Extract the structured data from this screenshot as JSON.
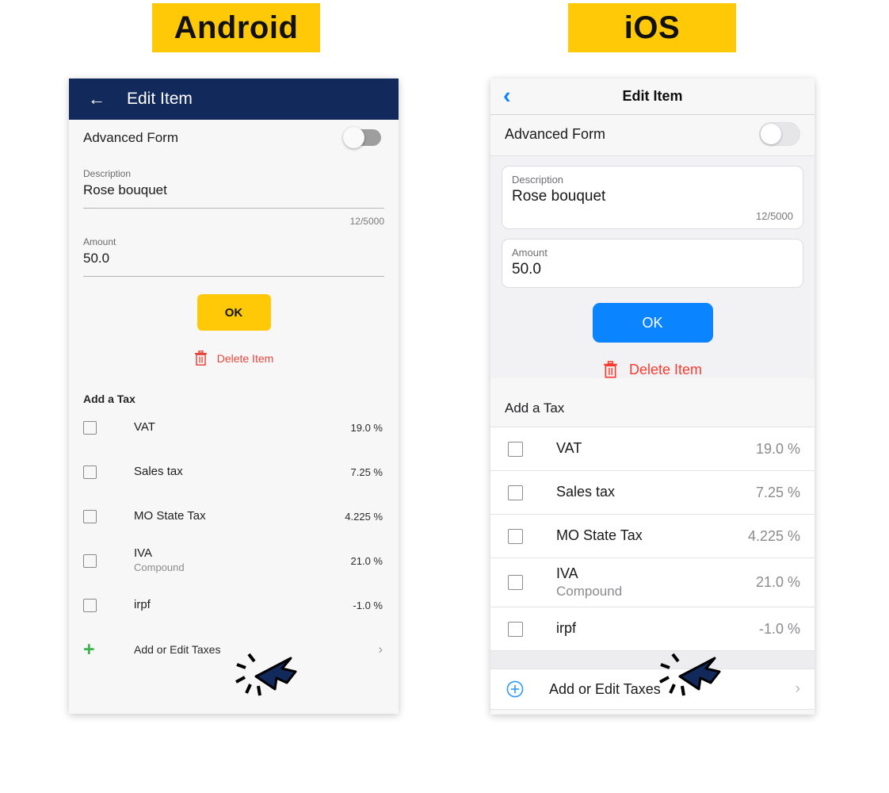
{
  "badges": {
    "android": "Android",
    "ios": "iOS"
  },
  "colors": {
    "badge_yellow": "#FFC907",
    "android_appbar": "#12295B",
    "android_ok": "#FFC907",
    "ios_blue": "#0A84FF",
    "delete_red_android": "#E8453C",
    "delete_red_ios": "#FA3B30",
    "plus_green": "#3CB44A",
    "cursor_navy": "#12295B"
  },
  "android": {
    "appbar": {
      "back_icon": "arrow-left-icon",
      "title": "Edit Item"
    },
    "advanced_form": {
      "label": "Advanced Form",
      "toggle_state": "off"
    },
    "description_field": {
      "label": "Description",
      "value": "Rose bouquet",
      "counter": "12/5000"
    },
    "amount_field": {
      "label": "Amount",
      "value": "50.0"
    },
    "ok_button": "OK",
    "delete": {
      "icon": "trash-icon",
      "label": "Delete Item"
    },
    "section_header": "Add a Tax",
    "taxes": [
      {
        "name": "VAT",
        "sub": "",
        "percent": "19.0 %"
      },
      {
        "name": "Sales tax",
        "sub": "",
        "percent": "7.25 %"
      },
      {
        "name": "MO State Tax",
        "sub": "",
        "percent": "4.225 %"
      },
      {
        "name": "IVA",
        "sub": "Compound",
        "percent": "21.0 %"
      },
      {
        "name": "irpf",
        "sub": "",
        "percent": "-1.0 %"
      }
    ],
    "add_row": {
      "icon": "plus-icon",
      "label": "Add or Edit Taxes",
      "chevron": "chevron-right-icon"
    }
  },
  "ios": {
    "navbar": {
      "back_icon": "chevron-left-icon",
      "title": "Edit Item"
    },
    "advanced_form": {
      "label": "Advanced Form",
      "toggle_state": "off"
    },
    "description_field": {
      "label": "Description",
      "value": "Rose bouquet",
      "counter": "12/5000"
    },
    "amount_field": {
      "label": "Amount",
      "value": "50.0"
    },
    "ok_button": "OK",
    "delete": {
      "icon": "trash-icon",
      "label": "Delete Item"
    },
    "section_header": "Add a Tax",
    "taxes": [
      {
        "name": "VAT",
        "sub": "",
        "percent": "19.0 %"
      },
      {
        "name": "Sales tax",
        "sub": "",
        "percent": "7.25 %"
      },
      {
        "name": "MO State Tax",
        "sub": "",
        "percent": "4.225 %"
      },
      {
        "name": "IVA",
        "sub": "Compound",
        "percent": "21.0 %"
      },
      {
        "name": "irpf",
        "sub": "",
        "percent": "-1.0 %"
      }
    ],
    "add_row": {
      "icon": "plus-circle-icon",
      "label": "Add or Edit Taxes",
      "chevron": "chevron-right-icon"
    }
  }
}
